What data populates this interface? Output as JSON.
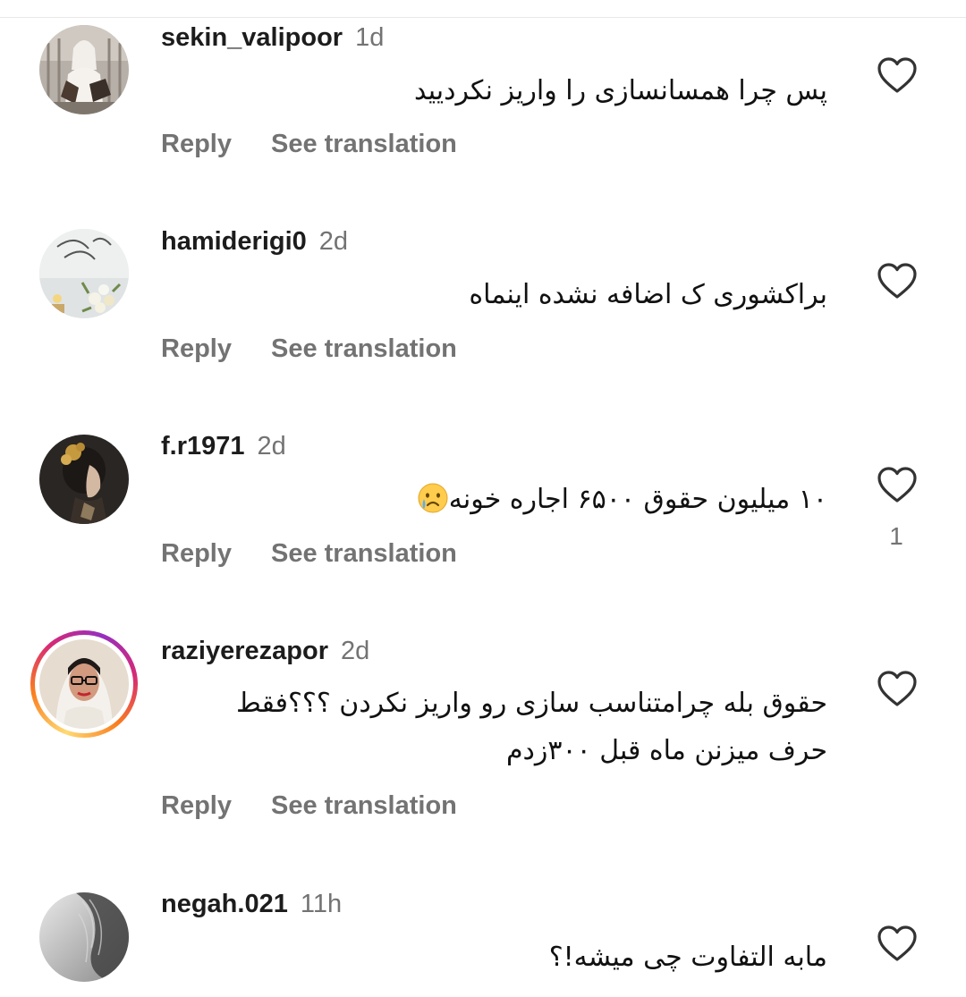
{
  "comments": [
    {
      "username": "sekin_valipoor",
      "time": "1d",
      "text": "پس چرا همسانسازی را واریز نکردیید",
      "reply_label": "Reply",
      "translate_label": "See translation",
      "like_icon": "heart-outline-icon"
    },
    {
      "username": "hamiderigi0",
      "time": "2d",
      "text": "براکشوری ک اضافه نشده اینماه",
      "reply_label": "Reply",
      "translate_label": "See translation",
      "like_icon": "heart-outline-icon"
    },
    {
      "username": "f.r1971",
      "time": "2d",
      "text": "۱۰ میلیون حقوق ۶۵۰۰  اجاره خونه",
      "emoji": "crying-face-emoji",
      "reply_label": "Reply",
      "translate_label": "See translation",
      "like_icon": "heart-outline-icon",
      "like_count": "1"
    },
    {
      "username": "raziyerezapor",
      "time": "2d",
      "text_line1": "حقوق بله چرامتناسب سازی رو واریز نکردن ؟؟؟فقط",
      "text_line2": "حرف میزنن ماه قبل ۳۰۰زدم",
      "has_story_ring": true,
      "reply_label": "Reply",
      "translate_label": "See translation",
      "like_icon": "heart-outline-icon"
    },
    {
      "username": "negah.021",
      "time": "11h",
      "text": "مابه التفاوت چی میشه!؟",
      "like_icon": "heart-outline-icon"
    }
  ],
  "colors": {
    "primary_text": "#1c1c1c",
    "secondary_text": "#737373",
    "story_ring_start": "#feda75",
    "story_ring_end": "#962fbf"
  }
}
